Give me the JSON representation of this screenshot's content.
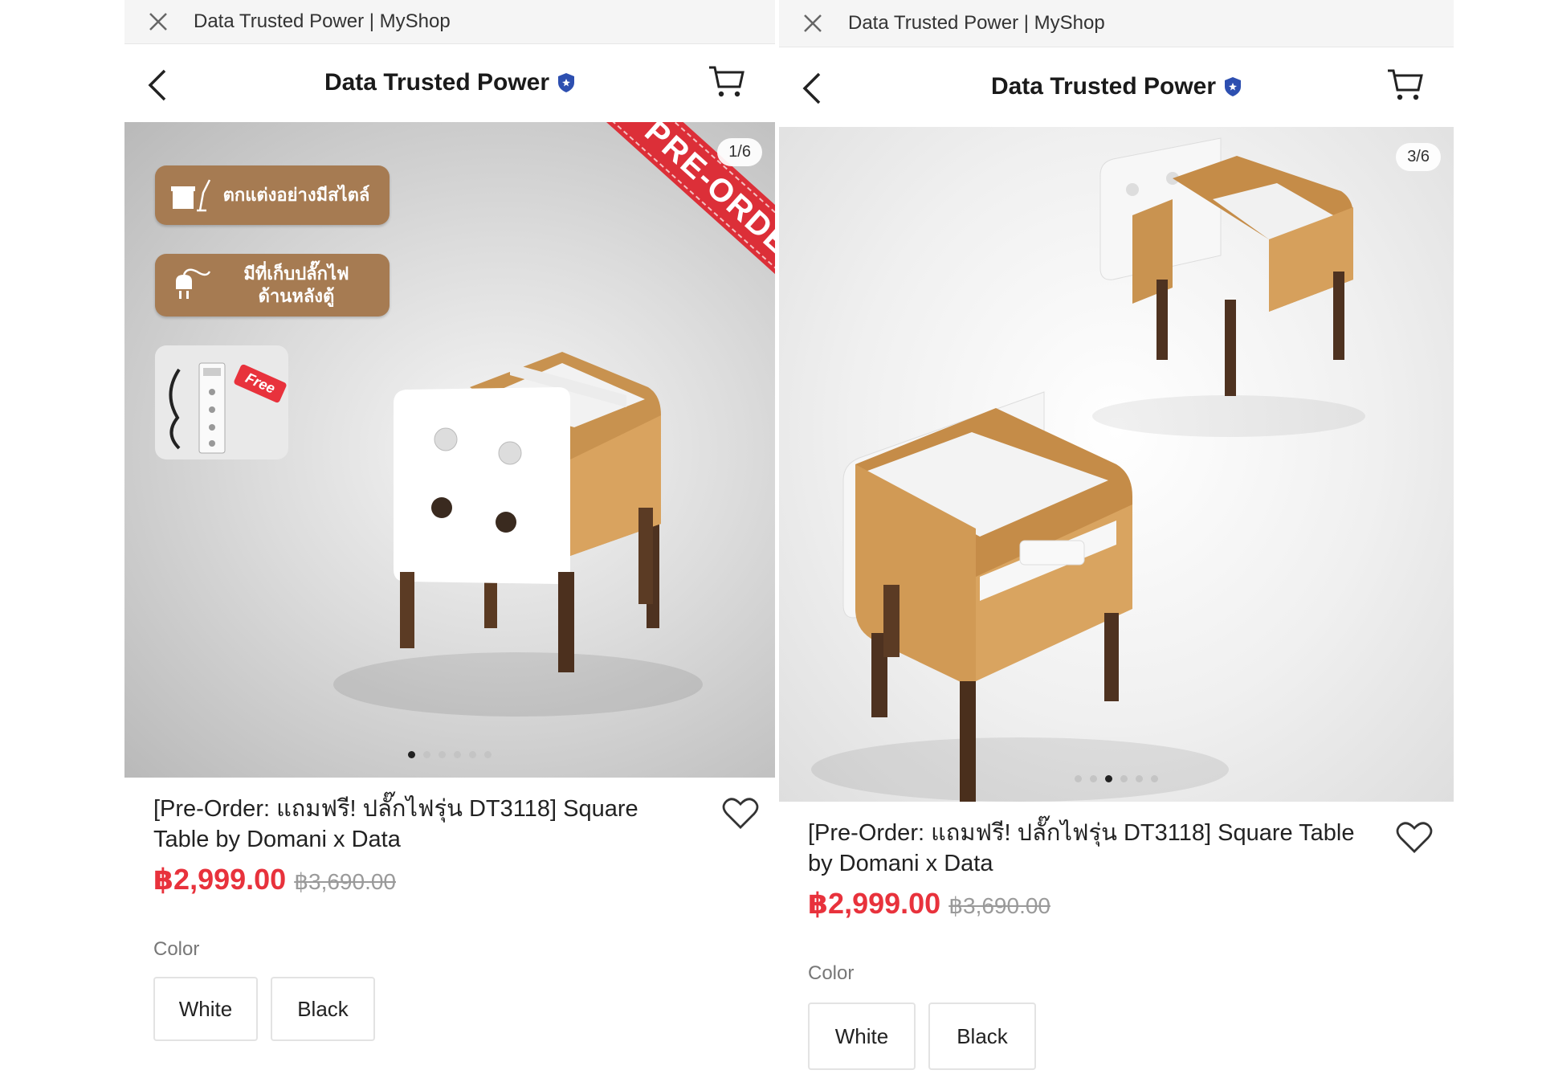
{
  "colors": {
    "price": "#e8323c",
    "pill": "#a67b52",
    "ribbon": "#dc2f38",
    "verified": "#2d4fb0"
  },
  "icons": [
    "close-icon",
    "back-arrow-icon",
    "cart-icon",
    "verified-shield-icon",
    "heart-icon"
  ],
  "screens": [
    {
      "window_title": "Data Trusted Power | MyShop",
      "shop_name": "Data Trusted Power",
      "image_counter": "1/6",
      "current_image": 1,
      "image_total": 6,
      "ribbon": "PRE-ORDER",
      "feature_1": "ตกแต่งอย่างมีสไตล์",
      "feature_2_line1": "มีที่เก็บปลั๊กไฟ",
      "feature_2_line2": "ด้านหลังตู้",
      "free_tag": "Free",
      "product_title": "[Pre-Order: แถมฟรี! ปลั๊กไฟรุ่น DT3118] Square Table by Domani x Data",
      "price": "฿2,999.00",
      "original_price": "฿3,690.00",
      "color_label": "Color",
      "color_options": [
        "White",
        "Black"
      ]
    },
    {
      "window_title": "Data Trusted Power | MyShop",
      "shop_name": "Data Trusted Power",
      "image_counter": "3/6",
      "current_image": 3,
      "image_total": 6,
      "product_title": "[Pre-Order: แถมฟรี! ปลั๊กไฟรุ่น DT3118] Square Table by Domani x Data",
      "price": "฿2,999.00",
      "original_price": "฿3,690.00",
      "color_label": "Color",
      "color_options": [
        "White",
        "Black"
      ]
    }
  ]
}
